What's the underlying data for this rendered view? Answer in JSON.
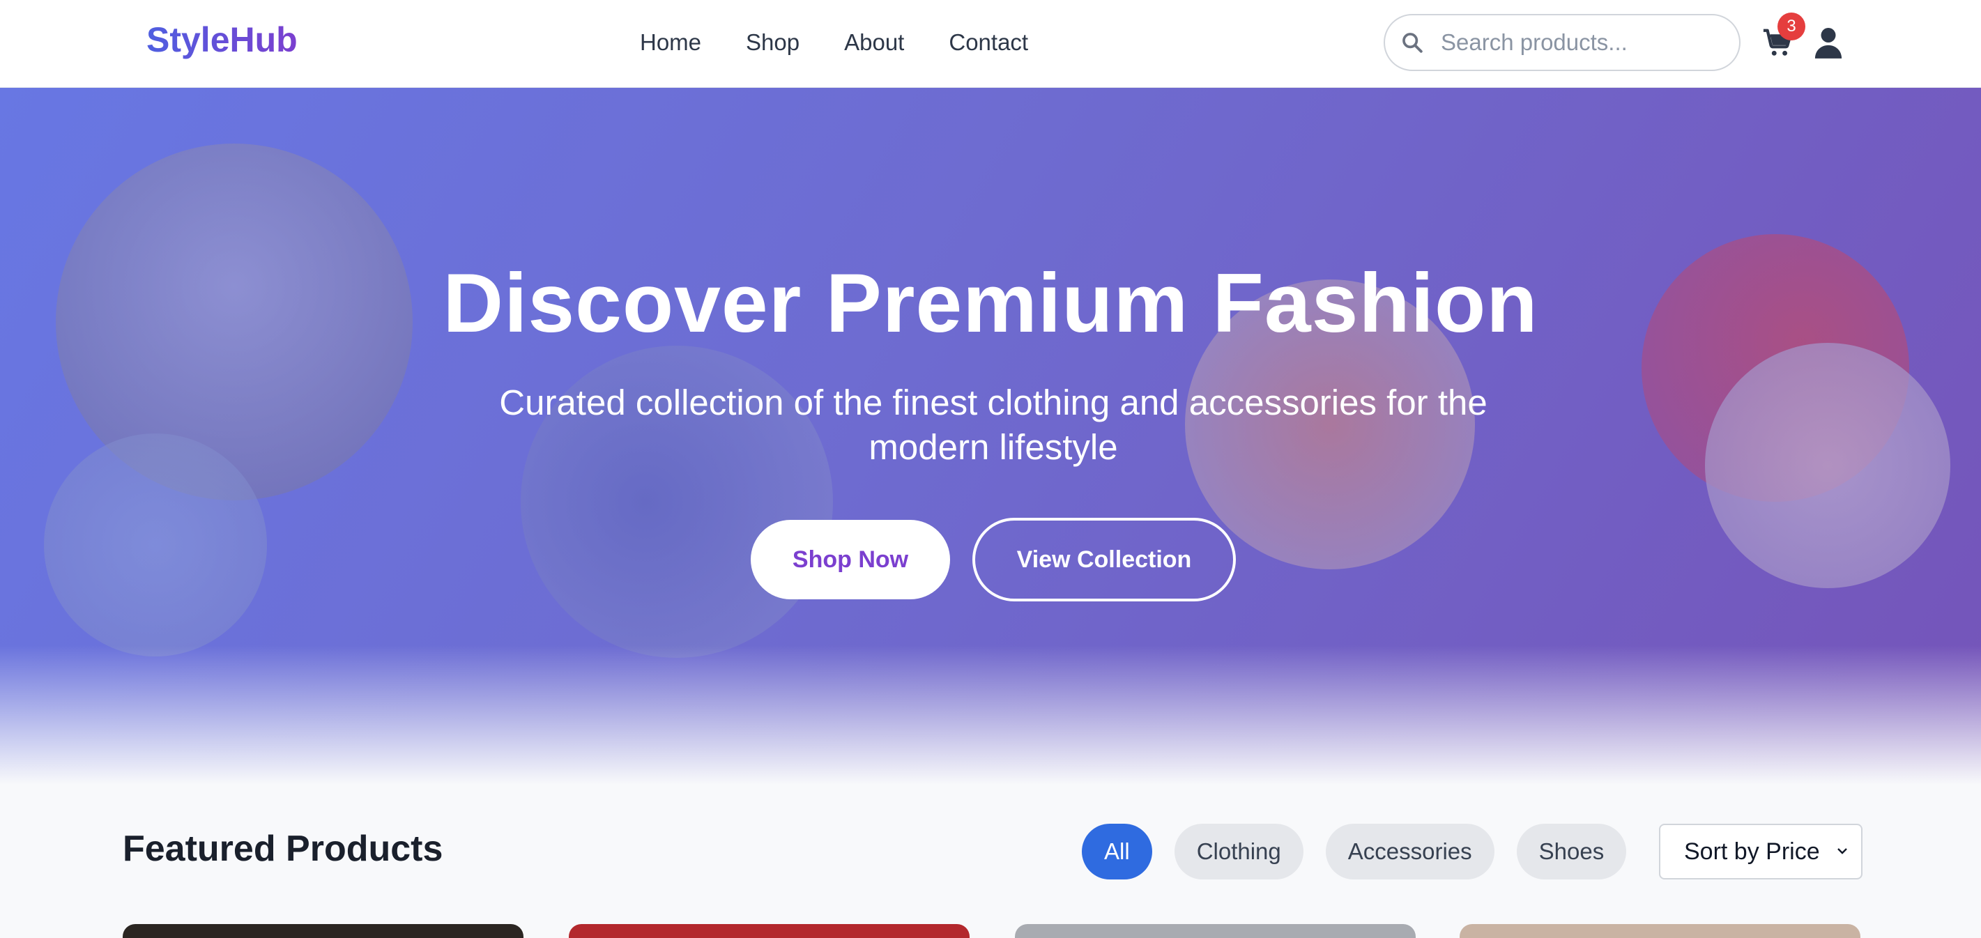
{
  "header": {
    "logo": "StyleHub",
    "nav": [
      "Home",
      "Shop",
      "About",
      "Contact"
    ],
    "search_placeholder": "Search products...",
    "cart_count": "3"
  },
  "hero": {
    "title": "Discover Premium Fashion",
    "subtitle": "Curated collection of the finest clothing and accessories for the modern lifestyle",
    "primary_button": "Shop Now",
    "secondary_button": "View Collection"
  },
  "featured": {
    "title": "Featured Products",
    "filters": [
      "All",
      "Clothing",
      "Accessories",
      "Shoes"
    ],
    "active_filter": "All",
    "sort_label": "Sort by Price"
  },
  "colors": {
    "brand_gradient_start": "#4f5fe0",
    "brand_gradient_end": "#7b3fcf",
    "active_filter": "#2f6be0",
    "badge": "#e53e3e"
  },
  "icons": {
    "search": "search-icon",
    "cart": "cart-icon",
    "user": "user-icon",
    "sort": "chevron-down-icon"
  }
}
